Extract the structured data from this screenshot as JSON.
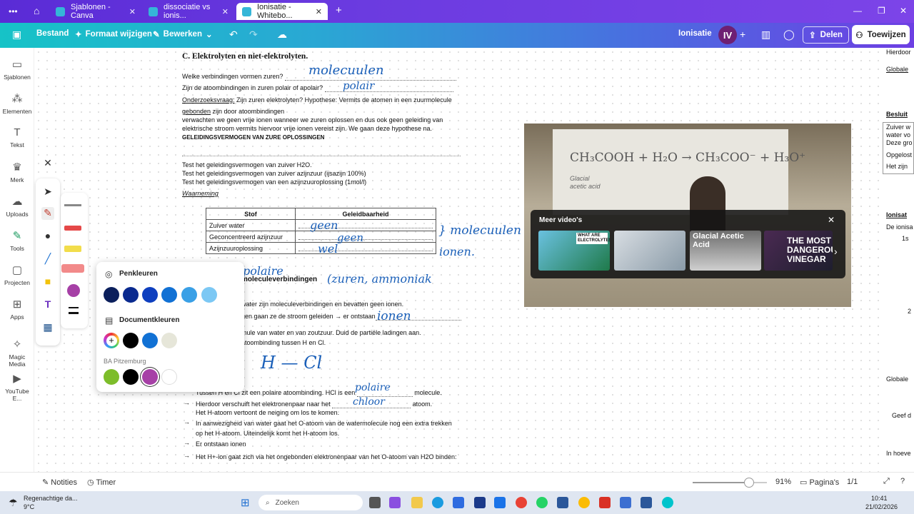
{
  "browser": {
    "tabs": [
      {
        "title": "Sjablonen - Canva"
      },
      {
        "title": "dissociatie vs ionis..."
      },
      {
        "title": "Ionisatie - Whitebo..."
      }
    ],
    "new_tab": "+",
    "more": "•••",
    "home": "⌂",
    "min": "—",
    "max": "❐",
    "close": "✕"
  },
  "toolbar": {
    "file": "Bestand",
    "resize": "Formaat wijzigen",
    "edit": "Bewerken",
    "title": "Ionisatie",
    "avatar": "IV",
    "share": "Delen",
    "assign": "Toewijzen"
  },
  "sidebar": {
    "items": [
      {
        "label": "Sjablonen",
        "icon": "template-icon"
      },
      {
        "label": "Elementen",
        "icon": "elements-icon"
      },
      {
        "label": "Tekst",
        "icon": "text-icon"
      },
      {
        "label": "Merk",
        "icon": "brand-icon"
      },
      {
        "label": "Uploads",
        "icon": "upload-icon"
      },
      {
        "label": "Tools",
        "icon": "tools-icon"
      },
      {
        "label": "Projecten",
        "icon": "folder-icon"
      },
      {
        "label": "Apps",
        "icon": "apps-icon"
      },
      {
        "label": "Magic Media",
        "icon": "magic-icon"
      },
      {
        "label": "YouTube E...",
        "icon": "youtube-icon"
      }
    ]
  },
  "doc": {
    "heading": "C.    Elektrolyten en niet-elektrolyten.",
    "q1": "Welke verbindingen vormen zuren? ",
    "q2": "Zijn de atoombindingen in zuren polair of apolair? ",
    "research_label": "Onderzoeksvraag:",
    "research_text": " Zijn zuren elektrolyten? Hypothese: Vermits de atomen in een zuurmolecule",
    "l1_u": "gebonden",
    "l1": " zijn door atoombindingen",
    "l2": "verwachten we geen vrije ionen wanneer we zuren oplossen en dus ook geen geleiding van",
    "l3": "elektrische stroom vermits hiervoor vrije ionen vereist zijn. We gaan deze hypothese na.",
    "l4": "GELEIDINGSVERMOGEN VAN ZURE OPLOSSINGEN",
    "t1": "Test het geleidingsvermogen van zuiver H2O.",
    "t2": "Test het geleidingsvermogen van zuiver azijnzuur (ijsazijn 100%)",
    "t3": "Test het geleidingsvermogen van een azijnzuuroplossing (1mol/l)",
    "obs": "Waarneming",
    "table": {
      "headers": [
        "Stof",
        "Geleidbaarheid"
      ],
      "rows": [
        [
          "Zuiver water",
          ""
        ],
        [
          "Geconcentreerd azijnzuur",
          ""
        ],
        [
          "Azijnzuuroplossing",
          ""
        ]
      ]
    },
    "section2": "moleculeverbindingen",
    "s1": "water zijn moleculeverbindingen en bevatten geen ionen.",
    "s2": "gen gaan ze de stroom geleiden → er ontstaan",
    "s3": "mule van water en van zoutzuur. Duid de partiële ladingen aan.",
    "s4": "atoombinding tussen H en Cl.",
    "p1": "Tussen H en Cl zit een polaire atoombinding. HCl is een ",
    "p1b": " molecule.",
    "p2": "Hierdoor verschuift het elektronenpaar naar het ",
    "p2b": " atoom.",
    "p3": "Het H-atoom vertoont de neiging om los te komen.",
    "p4": "In aanwezigheid van water gaat het O-atoom van de watermolecule nog een extra trekken",
    "p5": "op het H-atoom. Uiteindelijk komt het H-atoom los.",
    "p6": "Er ontstaan ionen",
    "p7": "Het H+-ion gaat zich via het ongebonden elektronenpaar van het O-atoom van H2O binden:",
    "arrow": "→"
  },
  "handwriting": {
    "h1": "molecuulen",
    "h2": "polair",
    "h3": "geen",
    "h4": "geen",
    "h5": "wel",
    "h6": "} molecuulen",
    "h7": "ionen.",
    "h8": "polaire",
    "h9": "(zuren, ammoniak",
    "h10": "ionen",
    "h11": "H — Cl",
    "h12": "polaire",
    "h13": "chloor"
  },
  "colors_popup": {
    "pen_colors_title": "Penkleuren",
    "doc_colors_title": "Documentkleuren",
    "brand_title": "BA Pitzemburg",
    "pen_colors": [
      "#0b1f5c",
      "#0a2a8f",
      "#0e3fbf",
      "#1171d4",
      "#3aa0e6",
      "#7cc8f4"
    ],
    "doc_colors": [
      "#000000",
      "#1171d4",
      "#e6e6d9"
    ],
    "brand_colors": [
      "#7dbd2a",
      "#000000",
      "#a640a6",
      "#ffffff"
    ]
  },
  "video": {
    "whiteboard_text": "CH₃COOH + H₂O → CH₃COO⁻ + H₃O⁺",
    "whiteboard_sub": "Glacial acetic acid",
    "more_videos": "Meer video's",
    "thumbs": [
      {
        "title": "WHAT ARE ELECTROLYTES?"
      },
      {
        "title": ""
      },
      {
        "title": "Glacial Acetic Acid"
      },
      {
        "title": "THE MOST DANGEROUS VINEGAR"
      }
    ],
    "close": "✕",
    "next": "›"
  },
  "right_panel": {
    "items": [
      "Hierdoor",
      "Globale",
      "Besluit",
      "Zuiver w",
      "water vo",
      "Deze gro",
      "Opgelost",
      "Het zijn",
      "Ionisat",
      "De ionisa",
      "1s",
      "2",
      "Globale",
      "Geef d",
      "In hoeve"
    ]
  },
  "bottom": {
    "notes": "Notities",
    "timer": "Timer",
    "zoom": "91%",
    "zoom_level": 0.91,
    "pages": "Pagina's",
    "page_count": "1/1"
  },
  "taskbar": {
    "weather_title": "Regenachtige da...",
    "weather_temp": "9°C",
    "search": "Zoeken",
    "time": "10:41",
    "date": "21/02/2026"
  }
}
